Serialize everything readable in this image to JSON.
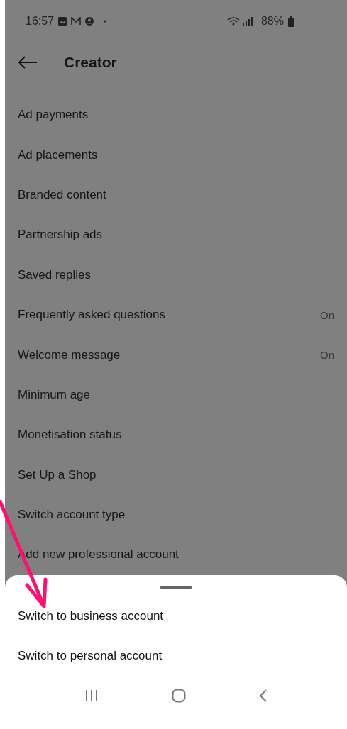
{
  "status_bar": {
    "time": "16:57",
    "battery": "88%"
  },
  "header": {
    "title": "Creator"
  },
  "items": [
    {
      "label": "Ad payments"
    },
    {
      "label": "Ad placements"
    },
    {
      "label": "Branded content"
    },
    {
      "label": "Partnership ads"
    },
    {
      "label": "Saved replies"
    },
    {
      "label": "Frequently asked questions",
      "value": "On"
    },
    {
      "label": "Welcome message",
      "value": "On"
    },
    {
      "label": "Minimum age"
    },
    {
      "label": "Monetisation status"
    },
    {
      "label": "Set Up a Shop"
    },
    {
      "label": "Switch account type"
    },
    {
      "label": "Add new professional account"
    }
  ],
  "sheet": {
    "options": [
      "Switch to business account",
      "Switch to personal account"
    ]
  }
}
